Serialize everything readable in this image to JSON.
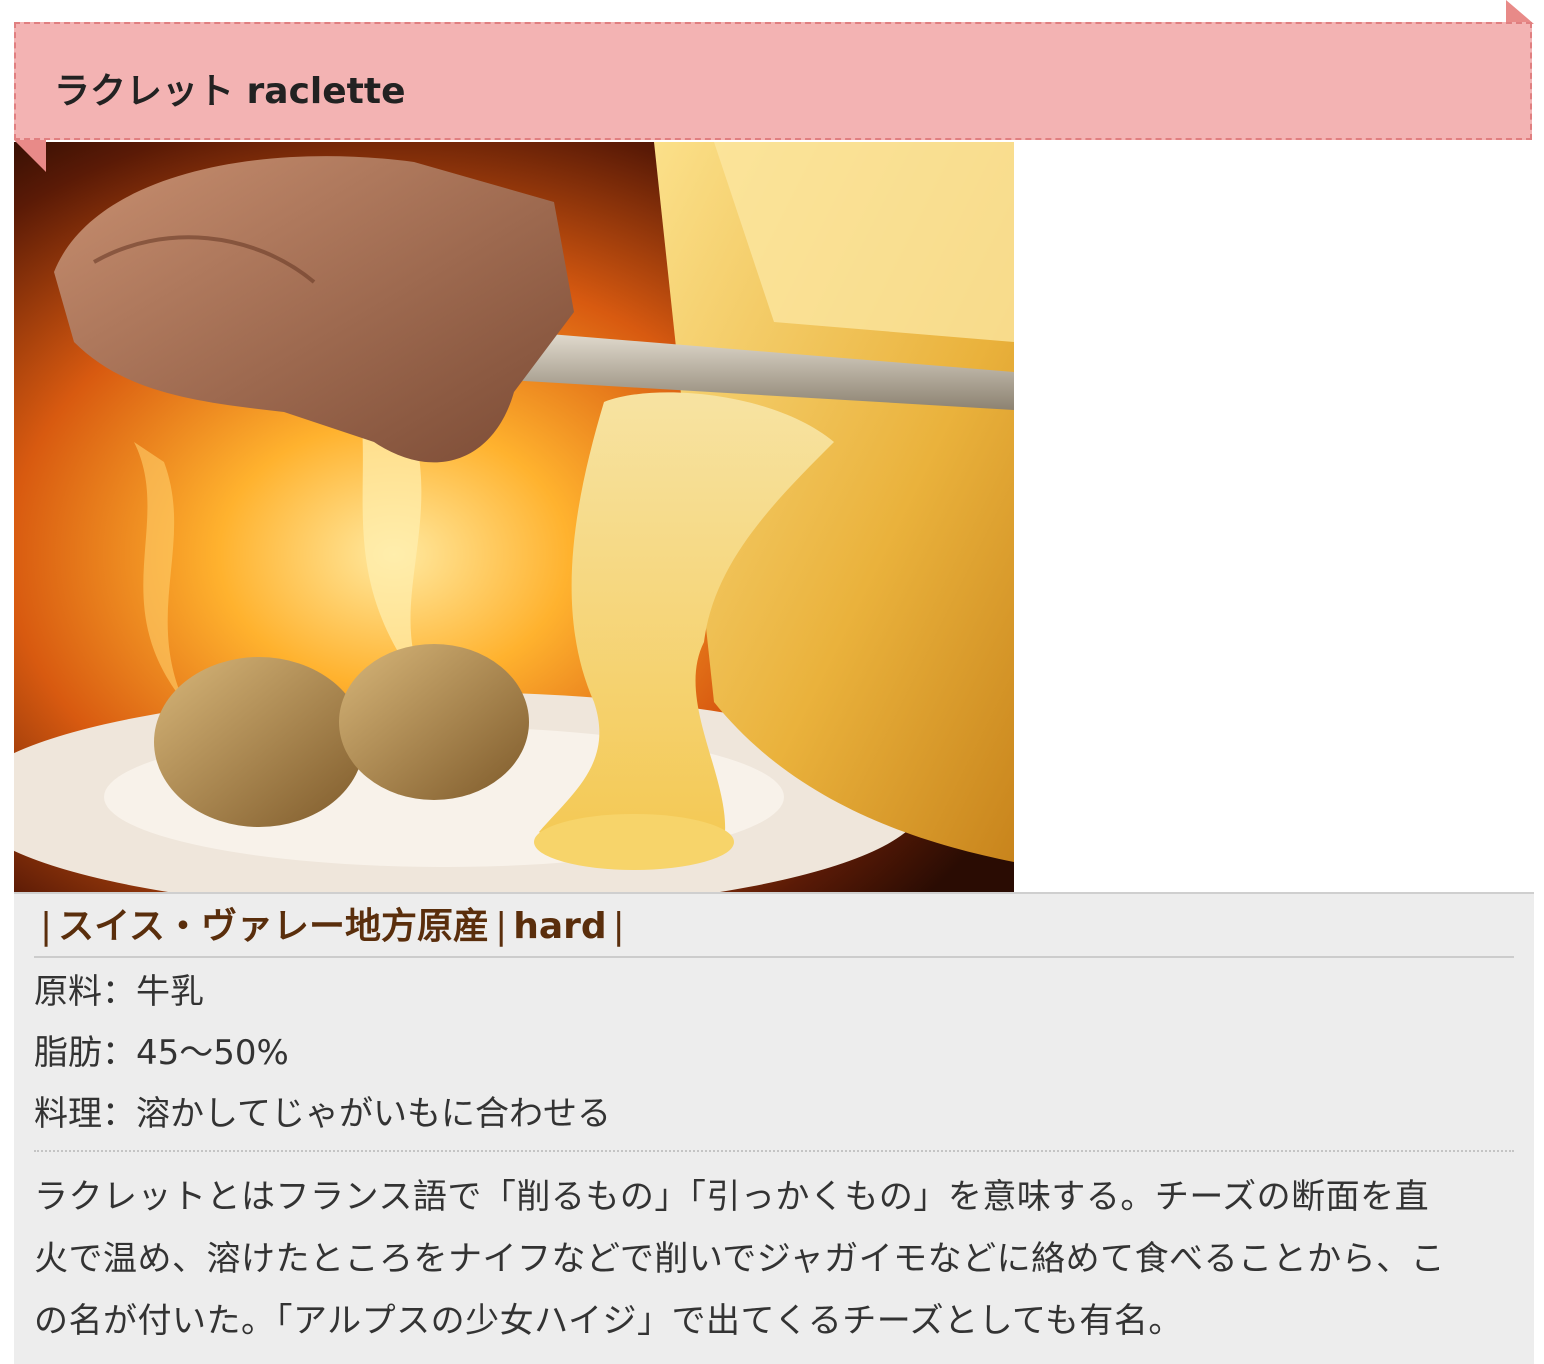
{
  "header": {
    "title": "ラクレット raclette"
  },
  "photo": {
    "alt": "raclette cheese being scraped onto potatoes"
  },
  "info": {
    "origin": "スイス・ヴァレー地方原産",
    "type": "hard",
    "specs": [
      {
        "label": "原料",
        "value": "牛乳"
      },
      {
        "label": "脂肪",
        "value": "45〜50%"
      },
      {
        "label": "料理",
        "value": "溶かしてじゃがいもに合わせる"
      }
    ],
    "description_lines": [
      "ラクレットとはフランス語で「削るもの」「引っかくもの」を意味する。チーズの断面を直",
      "火で温め、溶けたところをナイフなどで削いでジャガイモなどに絡めて食べることから、こ",
      "の名が付いた。「アルプスの少女ハイジ」で出てくるチーズとしても有名。"
    ]
  },
  "colors": {
    "ribbon": "#f3b3b3",
    "ribbon_border": "#e07f80",
    "heading_text": "#5a2e0c",
    "info_bg": "#ededed"
  }
}
